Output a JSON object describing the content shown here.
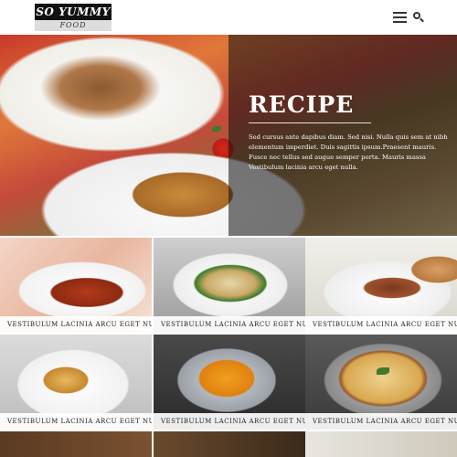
{
  "header": {
    "logo_top": "SO YUMMY",
    "logo_bottom": "FOOD",
    "menu_icon": "list-menu-icon",
    "search_icon": "search-icon"
  },
  "hero": {
    "title": "RECIPE",
    "text": "Sed cursus ante dapibus diam. Sed nisi. Nulla quis sem at nibh elementum imperdiet. Duis sagittis ipsum.Praesent mauris. Fusce nec tellus sed augue semper porta. Mauris massa Vestibulum lacinia arcu eget nulla."
  },
  "grid": {
    "tiles": [
      {
        "caption": "VESTIBULUM LACINIA ARCU EGET NULLA."
      },
      {
        "caption": "VESTIBULUM LACINIA ARCU EGET NULLA."
      },
      {
        "caption": "VESTIBULUM LACINIA ARCU EGET NULLA."
      },
      {
        "caption": "VESTIBULUM LACINIA ARCU EGET NULLA."
      },
      {
        "caption": "VESTIBULUM LACINIA ARCU EGET NULLA."
      },
      {
        "caption": "VESTIBULUM LACINIA ARCU EGET NULLA."
      }
    ]
  }
}
